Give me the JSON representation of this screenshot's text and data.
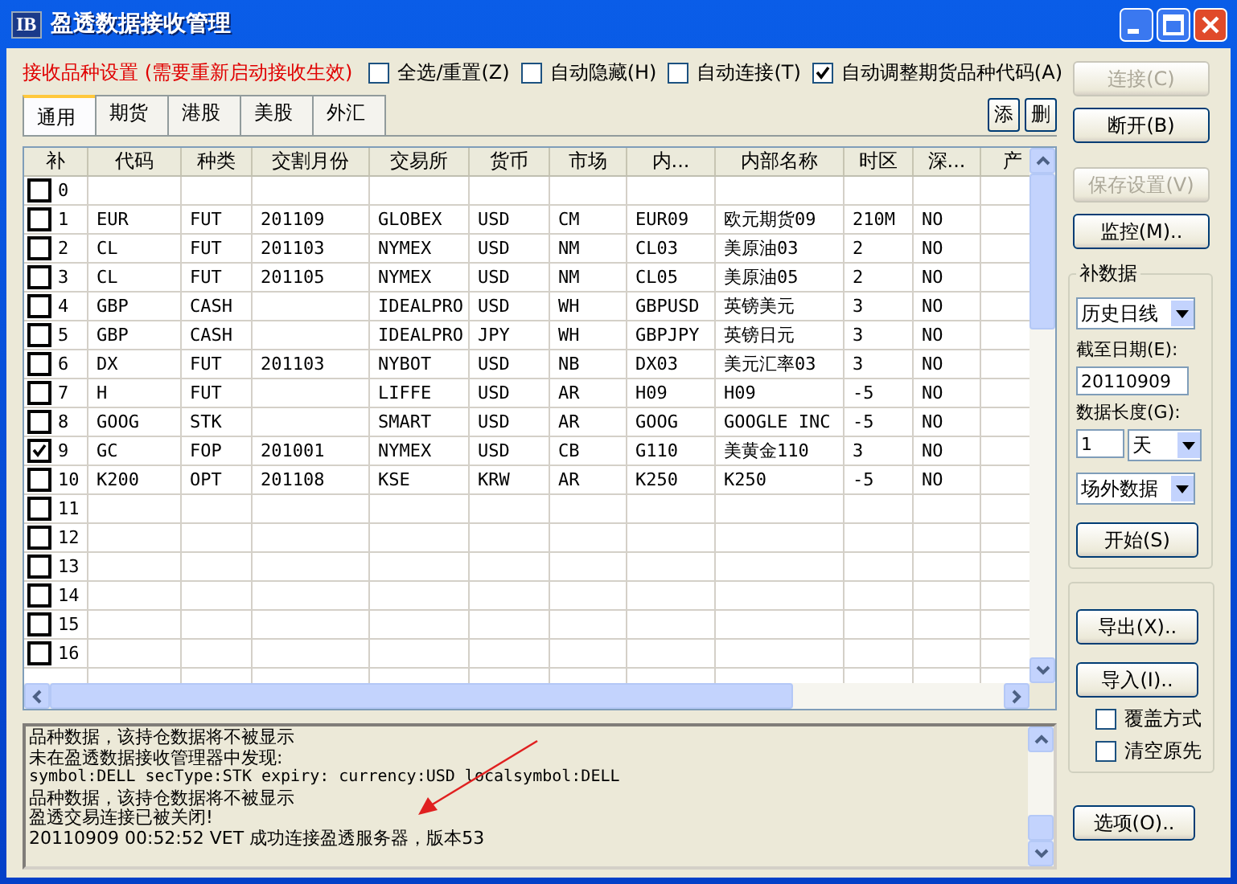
{
  "window": {
    "icon": "IB",
    "title": "盈透数据接收管理"
  },
  "options": {
    "label": "接收品种设置 (需要重新启动接收生效)",
    "checkboxes": [
      {
        "label": "全选/重置(Z)",
        "checked": false
      },
      {
        "label": "自动隐藏(H)",
        "checked": false
      },
      {
        "label": "自动连接(T)",
        "checked": false
      },
      {
        "label": "自动调整期货品种代码(A)",
        "checked": true
      }
    ]
  },
  "tabs": [
    {
      "label": "通用",
      "selected": true
    },
    {
      "label": "期货",
      "selected": false
    },
    {
      "label": "港股",
      "selected": false
    },
    {
      "label": "美股",
      "selected": false
    },
    {
      "label": "外汇",
      "selected": false
    }
  ],
  "tab_buttons": [
    "添",
    "删"
  ],
  "table": {
    "columns": [
      "补",
      "代码",
      "种类",
      "交割月份",
      "交易所",
      "货币",
      "市场",
      "内...",
      "内部名称",
      "时区",
      "深...",
      "产"
    ],
    "rows": [
      {
        "n": "0",
        "checked": false
      },
      {
        "n": "1",
        "checked": false,
        "code": "EUR",
        "type": "FUT",
        "month": "201109",
        "exchange": "GLOBEX",
        "currency": "USD",
        "market": "CM",
        "internal": "EUR09",
        "name": "欧元期货09",
        "tz": "210M",
        "depth": "NO"
      },
      {
        "n": "2",
        "checked": false,
        "code": "CL",
        "type": "FUT",
        "month": "201103",
        "exchange": "NYMEX",
        "currency": "USD",
        "market": "NM",
        "internal": "CL03",
        "name": "美原油03",
        "tz": "2",
        "depth": "NO"
      },
      {
        "n": "3",
        "checked": false,
        "code": "CL",
        "type": "FUT",
        "month": "201105",
        "exchange": "NYMEX",
        "currency": "USD",
        "market": "NM",
        "internal": "CL05",
        "name": "美原油05",
        "tz": "2",
        "depth": "NO"
      },
      {
        "n": "4",
        "checked": false,
        "code": "GBP",
        "type": "CASH",
        "exchange": "IDEALPRO",
        "currency": "USD",
        "market": "WH",
        "internal": "GBPUSD",
        "name": "英镑美元",
        "tz": "3",
        "depth": "NO"
      },
      {
        "n": "5",
        "checked": false,
        "code": "GBP",
        "type": "CASH",
        "exchange": "IDEALPRO",
        "currency": "JPY",
        "market": "WH",
        "internal": "GBPJPY",
        "name": "英镑日元",
        "tz": "3",
        "depth": "NO"
      },
      {
        "n": "6",
        "checked": false,
        "code": "DX",
        "type": "FUT",
        "month": "201103",
        "exchange": "NYBOT",
        "currency": "USD",
        "market": "NB",
        "internal": "DX03",
        "name": "美元汇率03",
        "tz": "3",
        "depth": "NO"
      },
      {
        "n": "7",
        "checked": false,
        "code": "H",
        "type": "FUT",
        "exchange": "LIFFE",
        "currency": "USD",
        "market": "AR",
        "internal": "H09",
        "name": "H09",
        "tz": "-5",
        "depth": "NO"
      },
      {
        "n": "8",
        "checked": false,
        "code": "GOOG",
        "type": "STK",
        "exchange": "SMART",
        "currency": "USD",
        "market": "AR",
        "internal": "GOOG",
        "name": "GOOGLE INC",
        "tz": "-5",
        "depth": "NO"
      },
      {
        "n": "9",
        "checked": true,
        "code": "GC",
        "type": "FOP",
        "month": "201001",
        "exchange": "NYMEX",
        "currency": "USD",
        "market": "CB",
        "internal": "G110",
        "name": "美黄金110",
        "tz": "3",
        "depth": "NO"
      },
      {
        "n": "10",
        "checked": false,
        "code": "K200",
        "type": "OPT",
        "month": "201108",
        "exchange": "KSE",
        "currency": "KRW",
        "market": "AR",
        "internal": "K250",
        "name": "K250",
        "tz": "-5",
        "depth": "NO"
      },
      {
        "n": "11",
        "checked": false
      },
      {
        "n": "12",
        "checked": false
      },
      {
        "n": "13",
        "checked": false
      },
      {
        "n": "14",
        "checked": false
      },
      {
        "n": "15",
        "checked": false
      },
      {
        "n": "16",
        "checked": false
      }
    ]
  },
  "log": [
    "品种数据，该持仓数据将不被显示",
    "未在盈透数据接收管理器中发现:",
    "symbol:DELL secType:STK expiry: currency:USD localsymbol:DELL",
    "品种数据，该持仓数据将不被显示",
    "盈透交易连接已被关闭!",
    "20110909 00:52:52 VET 成功连接盈透服务器，版本53"
  ],
  "side": {
    "connect": {
      "label": "连接(C)",
      "disabled": true
    },
    "disconnect": {
      "label": "断开(B)",
      "disabled": false
    },
    "save": {
      "label": "保存设置(V)",
      "disabled": true
    },
    "monitor": {
      "label": "监控(M)..",
      "disabled": false
    },
    "fill": {
      "title": "补数据",
      "period": "历史日线",
      "date_label": "截至日期(E):",
      "date": "20110909",
      "length_label": "数据长度(G):",
      "length": "1",
      "unit": "天",
      "source": "场外数据",
      "start": "开始(S)"
    },
    "export": "导出(X)..",
    "import": "导入(I)..",
    "checks": [
      {
        "label": "覆盖方式",
        "checked": false
      },
      {
        "label": "清空原先",
        "checked": false
      }
    ],
    "options": "选项(O).."
  }
}
